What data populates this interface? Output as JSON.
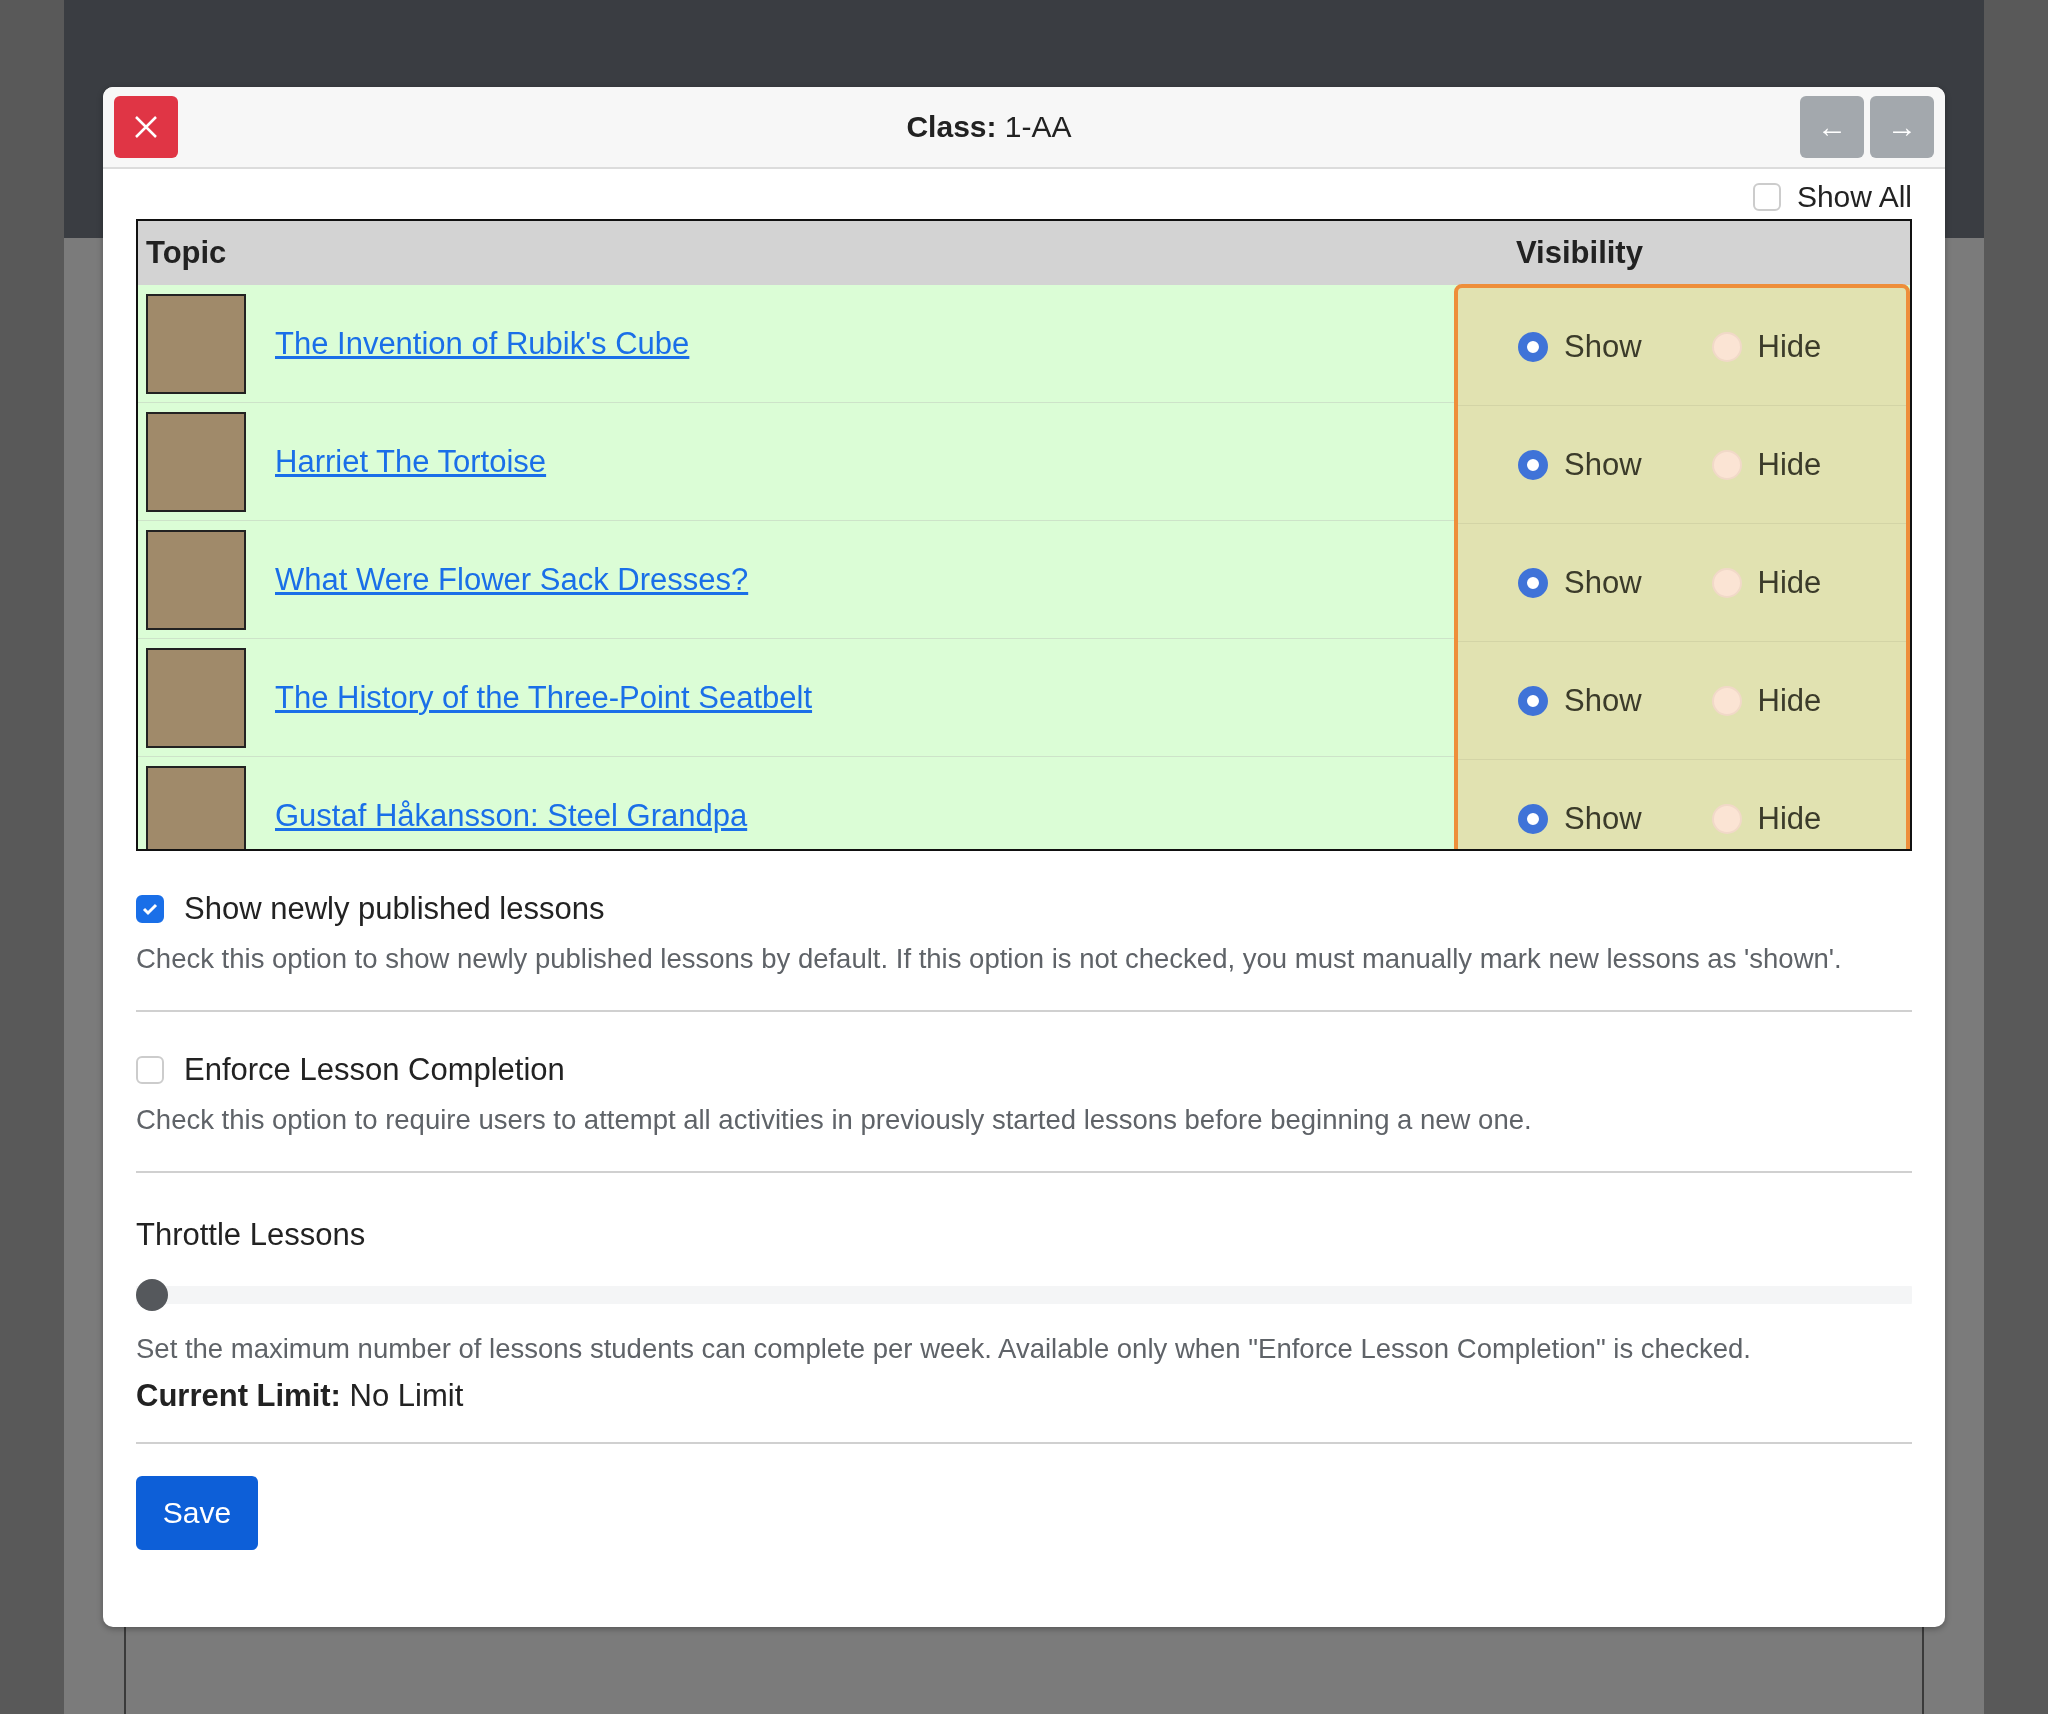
{
  "modal": {
    "title": "**Class:** 1-AA",
    "prev_button": "←",
    "next_button": "→"
  },
  "show_all": {
    "label": "Show All",
    "checked": false
  },
  "table": {
    "columns": [
      "Topic",
      "Visibility"
    ],
    "rows": [
      {
        "title": "The Invention of Rubik's Cube",
        "show": {
          "label": "Show",
          "selected": true
        },
        "hide": {
          "label": "Hide",
          "selected": false
        }
      },
      {
        "title": "Harriet The Tortoise",
        "show": {
          "label": "Show",
          "selected": true
        },
        "hide": {
          "label": "Hide",
          "selected": false
        }
      },
      {
        "title": "What Were Flower Sack Dresses?",
        "show": {
          "label": "Show",
          "selected": true
        },
        "hide": {
          "label": "Hide",
          "selected": false
        }
      },
      {
        "title": "The History of the Three-Point Seatbelt",
        "show": {
          "label": "Show",
          "selected": true
        },
        "hide": {
          "label": "Hide",
          "selected": false
        }
      },
      {
        "title": "Gustaf Håkansson: Steel Grandpa",
        "show": {
          "label": "Show",
          "selected": true
        },
        "hide": {
          "label": "Hide",
          "selected": false
        }
      }
    ]
  },
  "options": [
    {
      "label": "Show newly published lessons",
      "checked": true,
      "description": "Check this option to show newly published lessons by default. If this option is not checked, you must manually mark new lessons as 'shown'."
    },
    {
      "label": "Enforce Lesson Completion",
      "checked": false,
      "description": "Check this option to require users to attempt all activities in previously started lessons before beginning a new one."
    }
  ],
  "throttle": {
    "label": "Throttle Lessons",
    "level": 0,
    "description": "Set the maximum number of lessons students can complete per week. Available only when \"Enforce Lesson Completion\" is checked.",
    "current_limit": "**Current Limit:** No Limit"
  },
  "save_button": "Save"
}
